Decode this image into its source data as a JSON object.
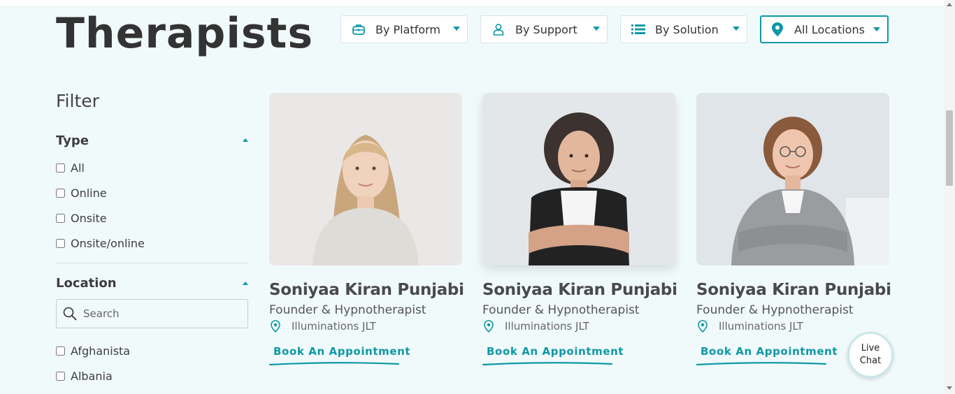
{
  "page": {
    "title": "Therapists"
  },
  "dropdowns": [
    {
      "label": "By Platform",
      "icon": "briefcase-icon"
    },
    {
      "label": "By Support",
      "icon": "user-icon"
    },
    {
      "label": "By Solution",
      "icon": "list-icon"
    },
    {
      "label": "All Locations",
      "icon": "map-pin-icon",
      "selected": true
    }
  ],
  "filter": {
    "title": "Filter",
    "type": {
      "title": "Type",
      "options": [
        "All",
        "Online",
        "Onsite",
        "Onsite/online"
      ]
    },
    "location": {
      "title": "Location",
      "search_placeholder": "Search",
      "options": [
        "Afghanista",
        "Albania"
      ]
    }
  },
  "cards": [
    {
      "name": "Soniyaa Kiran Punjabi",
      "role": "Founder & Hypnotherapist",
      "location": "Illuminations JLT",
      "cta": "Book An Appointment"
    },
    {
      "name": "Soniyaa Kiran Punjabi",
      "role": "Founder & Hypnotherapist",
      "location": "Illuminations JLT",
      "cta": "Book An Appointment"
    },
    {
      "name": "Soniyaa Kiran Punjabi",
      "role": "Founder & Hypnotherapist",
      "location": "Illuminations JLT",
      "cta": "Book An Appointment"
    }
  ],
  "live_chat": {
    "line1": "Live",
    "line2": "Chat"
  },
  "colors": {
    "accent": "#0e98a6",
    "background": "#f1fafb"
  }
}
